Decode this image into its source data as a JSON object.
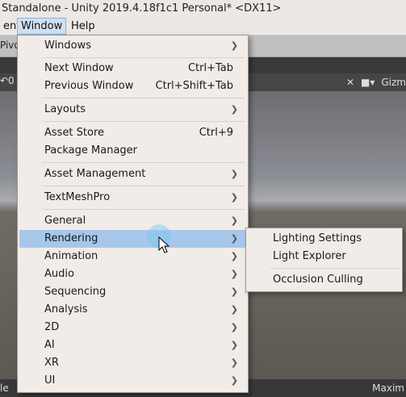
{
  "window": {
    "title": "Standalone - Unity 2019.4.18f1c1 Personal* <DX11>"
  },
  "menubar": {
    "items": [
      "ent",
      "Window",
      "Help"
    ]
  },
  "toolbar": {
    "pivot_label": "Pivo"
  },
  "scene": {
    "left_tab_fragment": "↶0",
    "gizmos_label": "Gizm"
  },
  "status": {
    "left_text": "le",
    "right_text": "Maxim"
  },
  "window_menu": {
    "items": [
      {
        "label": "Windows",
        "submenu": true
      },
      {
        "label": "Next Window",
        "shortcut": "Ctrl+Tab"
      },
      {
        "label": "Previous Window",
        "shortcut": "Ctrl+Shift+Tab"
      },
      {
        "label": "Layouts",
        "submenu": true
      },
      {
        "label": "Asset Store",
        "shortcut": "Ctrl+9"
      },
      {
        "label": "Package Manager"
      },
      {
        "label": "Asset Management",
        "submenu": true
      },
      {
        "label": "TextMeshPro",
        "submenu": true
      },
      {
        "label": "General",
        "submenu": true
      },
      {
        "label": "Rendering",
        "submenu": true,
        "highlighted": true
      },
      {
        "label": "Animation",
        "submenu": true
      },
      {
        "label": "Audio",
        "submenu": true
      },
      {
        "label": "Sequencing",
        "submenu": true
      },
      {
        "label": "Analysis",
        "submenu": true
      },
      {
        "label": "2D",
        "submenu": true
      },
      {
        "label": "AI",
        "submenu": true
      },
      {
        "label": "XR",
        "submenu": true
      },
      {
        "label": "UI",
        "submenu": true
      }
    ]
  },
  "rendering_submenu": {
    "items": [
      "Lighting Settings",
      "Light Explorer",
      "Occlusion Culling"
    ]
  },
  "icons": {
    "submenu_arrow": "chevron-right-icon",
    "cursor": "mouse-pointer-icon",
    "tools": "tools-icon",
    "camera": "camera-icon"
  },
  "colors": {
    "highlight": "#a7c7ea",
    "menu_bg": "#f1ece7"
  }
}
